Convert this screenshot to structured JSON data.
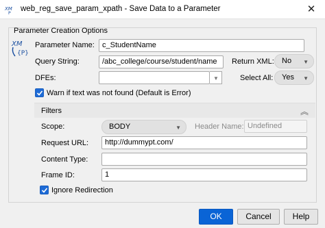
{
  "window": {
    "title": "web_reg_save_param_xpath - Save Data to a Parameter",
    "close_glyph": "✕"
  },
  "group": {
    "title": "Parameter Creation Options",
    "icon": "xml-parameter-icon"
  },
  "param_name": {
    "label": "Parameter Name:",
    "value": "c_StudentName"
  },
  "query_string": {
    "label": "Query String:",
    "value": "/abc_college/course/student/name"
  },
  "return_xml": {
    "label": "Return XML:",
    "value": "No"
  },
  "dfes": {
    "label": "DFEs:",
    "value": ""
  },
  "select_all": {
    "label": "Select All:",
    "value": "Yes"
  },
  "warn": {
    "label": "Warn if text was not found (Default is Error)",
    "checked": true
  },
  "filters": {
    "title": "Filters",
    "scope_label": "Scope:",
    "scope_value": "BODY",
    "header_name_label": "Header Name:",
    "header_name_value": "Undefined",
    "request_url_label": "Request URL:",
    "request_url_value": "http://dummypt.com/",
    "content_type_label": "Content Type:",
    "content_type_value": "",
    "frame_id_label": "Frame ID:",
    "frame_id_value": "1",
    "ignore_redirection_label": "Ignore Redirection",
    "ignore_redirection_checked": true
  },
  "buttons": {
    "ok": "OK",
    "cancel": "Cancel",
    "help": "Help"
  },
  "colors": {
    "accent": "#0a64d6",
    "checkbox": "#1e6bd6"
  }
}
